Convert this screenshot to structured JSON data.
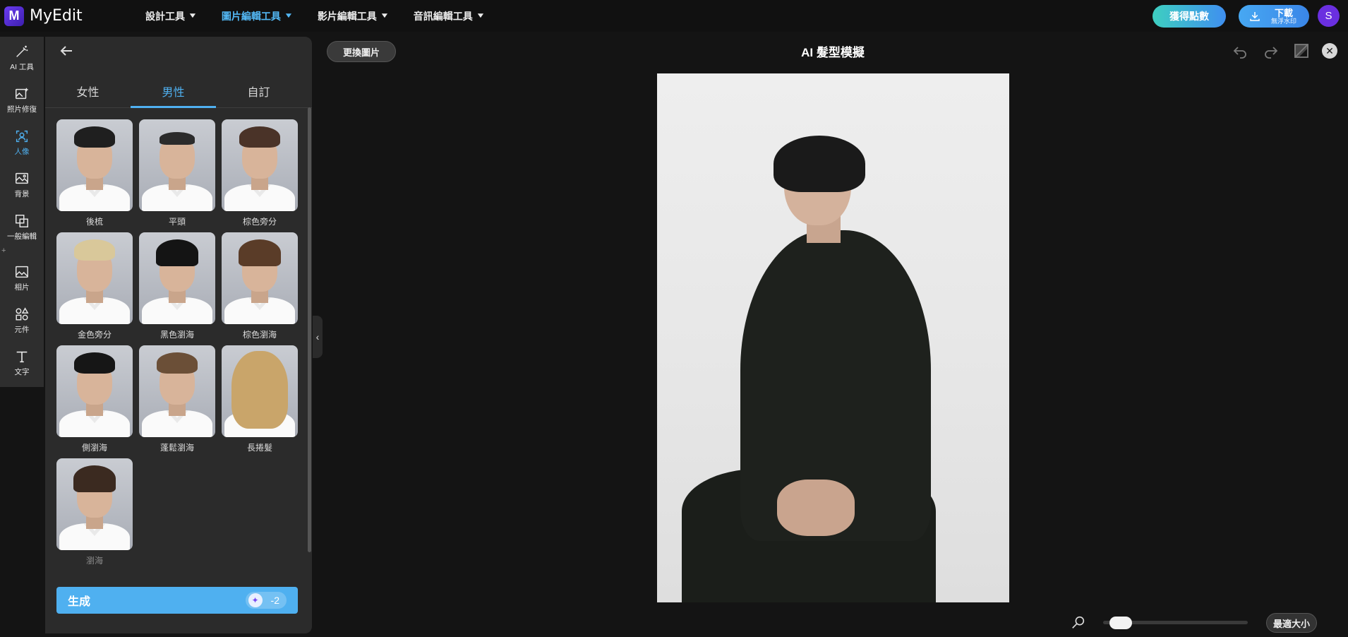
{
  "app": {
    "name": "MyEdit",
    "logo_letter": "M"
  },
  "nav": {
    "items": [
      {
        "label": "設計工具",
        "active": false
      },
      {
        "label": "圖片編輯工具",
        "active": true
      },
      {
        "label": "影片編輯工具",
        "active": false
      },
      {
        "label": "音訊編輯工具",
        "active": false
      }
    ],
    "chevron": "▼"
  },
  "header": {
    "points_label": "獲得點數",
    "download_label": "下載",
    "download_sub": "無浮水印",
    "avatar_letter": "S"
  },
  "rail": {
    "items": [
      {
        "label": "AI 工具",
        "icon": "magic-wand-icon",
        "active": false
      },
      {
        "label": "照片修復",
        "icon": "photo-repair-icon",
        "active": false
      },
      {
        "label": "人像",
        "icon": "portrait-icon",
        "active": true
      },
      {
        "label": "背景",
        "icon": "background-icon",
        "active": false
      },
      {
        "label": "一般編輯",
        "icon": "edit-icon",
        "active": false
      },
      {
        "label": "相片",
        "icon": "photo-icon",
        "active": false
      },
      {
        "label": "元件",
        "icon": "shapes-icon",
        "active": false
      },
      {
        "label": "文字",
        "icon": "text-icon",
        "active": false
      }
    ],
    "sep_glyph": "+"
  },
  "panel": {
    "tabs": [
      {
        "label": "女性",
        "active": false
      },
      {
        "label": "男性",
        "active": true
      },
      {
        "label": "自訂",
        "active": false
      }
    ],
    "styles": [
      {
        "label": "後梳",
        "hair": "#1f1f1f"
      },
      {
        "label": "平頭",
        "hair": "#2b2b2b"
      },
      {
        "label": "棕色旁分",
        "hair": "#4a3328"
      },
      {
        "label": "金色旁分",
        "hair": "#d9c89a"
      },
      {
        "label": "黑色瀏海",
        "hair": "#141414"
      },
      {
        "label": "棕色瀏海",
        "hair": "#5a3c28"
      },
      {
        "label": "側瀏海",
        "hair": "#161616"
      },
      {
        "label": "蓬鬆瀏海",
        "hair": "#6b4f37"
      },
      {
        "label": "長捲髮",
        "hair": "#c9a56a"
      },
      {
        "label": "瀏海",
        "hair": "#3b2a20"
      }
    ],
    "generate_label": "生成",
    "generate_cost": "-2",
    "coin_glyph": "✦",
    "collapse_glyph": "‹"
  },
  "canvas": {
    "replace_label": "更換圖片",
    "title": "AI 髮型模擬",
    "close_glyph": "✕",
    "fit_label": "最適大小",
    "zoom_level": 0.05
  }
}
